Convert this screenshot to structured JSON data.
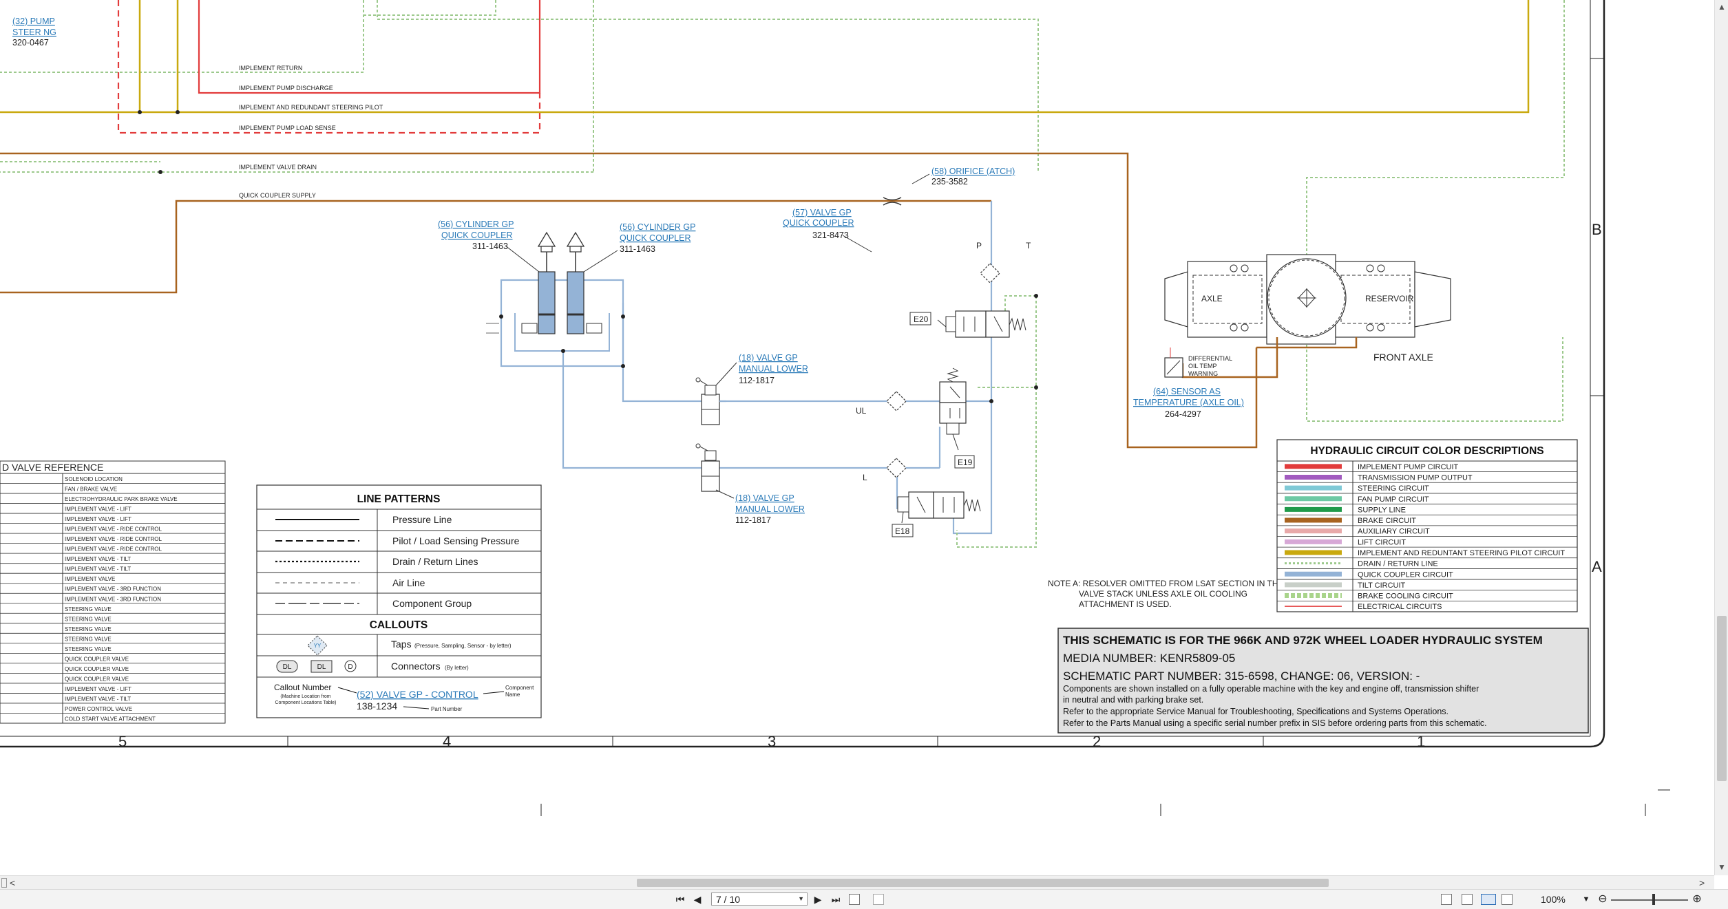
{
  "schematic": {
    "top_lines": {
      "implement_return": "IMPLEMENT RETURN",
      "implement_pump_discharge": "IMPLEMENT PUMP DISCHARGE",
      "implement_redundant_steering_pilot": "IMPLEMENT AND REDUNDANT STEERING PILOT",
      "implement_pump_load_sense": "IMPLEMENT PUMP LOAD SENSE",
      "implement_valve_drain": "IMPLEMENT VALVE DRAIN",
      "quick_coupler_supply": "QUICK COUPLER SUPPLY"
    },
    "callouts": {
      "pump_steering_link1": "(32) PUMP",
      "pump_steering_link2": "STEER NG",
      "pump_steering_pn": "320-0467",
      "orifice_link": "(58) ORIFICE (ATCH)",
      "orifice_pn": "235-3582",
      "valve57_link1": "(57) VALVE GP",
      "valve57_link2": "QUICK COUPLER",
      "valve57_pn": "321-8473",
      "cyl_left_link1": "(56) CYLINDER GP",
      "cyl_left_link2": "QUICK COUPLER",
      "cyl_left_pn": "311-1463",
      "cyl_right_link1": "(56) CYLINDER GP",
      "cyl_right_link2": "QUICK COUPLER",
      "cyl_right_pn": "311-1463",
      "valve18_upper_link1": "(18) VALVE GP",
      "valve18_upper_link2": "MANUAL LOWER",
      "valve18_upper_pn": "112-1817",
      "valve18_lower_link1": "(18) VALVE GP",
      "valve18_lower_link2": "MANUAL LOWER",
      "valve18_lower_pn": "112-1817",
      "sensor_link1": "(64) SENSOR AS",
      "sensor_link2": "TEMPERATURE (AXLE OIL)",
      "sensor_pn": "264-4297"
    },
    "ports": {
      "p": "P",
      "t": "T",
      "ul": "UL",
      "l": "L"
    },
    "connectors": {
      "e20": "E20",
      "e19": "E19",
      "e18": "E18"
    },
    "axle": {
      "axle": "AXLE",
      "reservoir": "RESERVOIR",
      "front_axle": "FRONT AXLE",
      "diff_line1": "DIFFERENTIAL",
      "diff_line2": "OIL TEMP",
      "diff_line3": "WARNING"
    },
    "note_a": {
      "line1": "NOTE A: RESOLVER OMITTED FROM LSAT SECTION IN THE",
      "line2": "VALVE STACK UNLESS AXLE OIL COOLING",
      "line3": "ATTACHMENT IS USED."
    },
    "zones": {
      "b": "B",
      "a": "A",
      "c5": "5",
      "c4": "4",
      "c3": "3",
      "c2": "2",
      "c1": "1"
    }
  },
  "solenoid_table": {
    "title": "D VALVE REFERENCE",
    "rows": [
      "SOLENOID LOCATION",
      "FAN / BRAKE VALVE",
      "ELECTROHYDRAULIC PARK BRAKE VALVE",
      "IMPLEMENT VALVE - LIFT",
      "IMPLEMENT VALVE - LIFT",
      "IMPLEMENT VALVE - RIDE CONTROL",
      "IMPLEMENT VALVE - RIDE CONTROL",
      "IMPLEMENT VALVE - RIDE CONTROL",
      "IMPLEMENT VALVE - TILT",
      "IMPLEMENT VALVE - TILT",
      "IMPLEMENT VALVE",
      "IMPLEMENT VALVE - 3RD FUNCTION",
      "IMPLEMENT VALVE - 3RD FUNCTION",
      "STEERING VALVE",
      "STEERING VALVE",
      "STEERING VALVE",
      "STEERING VALVE",
      "STEERING VALVE",
      "QUICK COUPLER VALVE",
      "QUICK COUPLER VALVE",
      "QUICK COUPLER VALVE",
      "IMPLEMENT VALVE - LIFT",
      "IMPLEMENT VALVE - TILT",
      "POWER CONTROL VALVE",
      "COLD START VALVE ATTACHMENT"
    ]
  },
  "line_patterns": {
    "title": "LINE PATTERNS",
    "rows": [
      "Pressure Line",
      "Pilot / Load Sensing Pressure",
      "Drain / Return Lines",
      "Air Line",
      "Component Group"
    ],
    "callouts_title": "CALLOUTS",
    "taps_label": "Taps",
    "taps_small": "(Pressure, Sampling, Sensor - by letter)",
    "taps_symbol": "YY",
    "connectors_label": "Connectors",
    "connectors_small": "(By letter)",
    "conn_dl1": "DL",
    "conn_dl2": "DL",
    "conn_d": "D",
    "callout_number": "Callout Number",
    "callout_sub1": "(Machine Location from",
    "callout_sub2": "Component Locations Table)",
    "callout_example": "(52) VALVE GP - CONTROL",
    "callout_pn": "138-1234",
    "part_number": "Part Number",
    "component_name1": "Component",
    "component_name2": "Name"
  },
  "color_descriptions": {
    "title": "HYDRAULIC CIRCUIT COLOR DESCRIPTIONS",
    "rows": [
      {
        "label": "IMPLEMENT PUMP CIRCUIT",
        "color": "#e23b3b",
        "style": "solid"
      },
      {
        "label": "TRANSMISSION PUMP OUTPUT",
        "color": "#a25bbf",
        "style": "solid"
      },
      {
        "label": "STEERING CIRCUIT",
        "color": "#7fc9d6",
        "style": "solid"
      },
      {
        "label": "FAN PUMP CIRCUIT",
        "color": "#6cc9a4",
        "style": "solid"
      },
      {
        "label": "SUPPLY LINE",
        "color": "#1f9a4a",
        "style": "solid"
      },
      {
        "label": "BRAKE CIRCUIT",
        "color": "#a8631f",
        "style": "solid"
      },
      {
        "label": "AUXILIARY CIRCUIT",
        "color": "#e8a9a9",
        "style": "solid"
      },
      {
        "label": "LIFT CIRCUIT",
        "color": "#d7a8d6",
        "style": "solid"
      },
      {
        "label": "IMPLEMENT AND REDUNTANT STEERING PILOT CIRCUIT",
        "color": "#c9a90f",
        "style": "solid"
      },
      {
        "label": "DRAIN / RETURN LINE",
        "color": "#9cc98c",
        "style": "dotted"
      },
      {
        "label": "QUICK COUPLER CIRCUIT",
        "color": "#94b3d6",
        "style": "solid"
      },
      {
        "label": "TILT CIRCUIT",
        "color": "#c8cfc8",
        "style": "solid"
      },
      {
        "label": "BRAKE COOLING CIRCUIT",
        "color": "#a9d48b",
        "style": "hatched"
      },
      {
        "label": "ELECTRICAL CIRCUITS",
        "color": "#e23b3b",
        "style": "thin"
      }
    ]
  },
  "info_block": {
    "title": "THIS SCHEMATIC IS FOR THE 966K AND 972K WHEEL LOADER HYDRAULIC SYSTEM",
    "media": "MEDIA NUMBER: KENR5809-05",
    "part": "SCHEMATIC PART NUMBER: 315-6598, CHANGE: 06, VERSION: -",
    "note1": "Components are shown installed on a fully operable machine with the key and engine off, transmission shifter",
    "note2": "in neutral and with parking brake set.",
    "note3": "Refer to the appropriate Service Manual for Troubleshooting, Specifications and Systems Operations.",
    "note4": "Refer to the Parts Manual using a specific serial number prefix in SIS before ordering parts from this schematic."
  },
  "viewer": {
    "page_indicator": "7 / 10",
    "zoom": "100%",
    "nav_first": "⏮",
    "nav_prev": "◀",
    "nav_next": "▶",
    "nav_last": "⏭",
    "scroll_left": "<",
    "scroll_right": ">"
  },
  "line_colors": {
    "red": "#e23b3b",
    "yellow": "#c9a90f",
    "brown": "#a8631f",
    "drain_green": "#9cc98c",
    "quick_coupler_blue": "#94b3d6"
  }
}
